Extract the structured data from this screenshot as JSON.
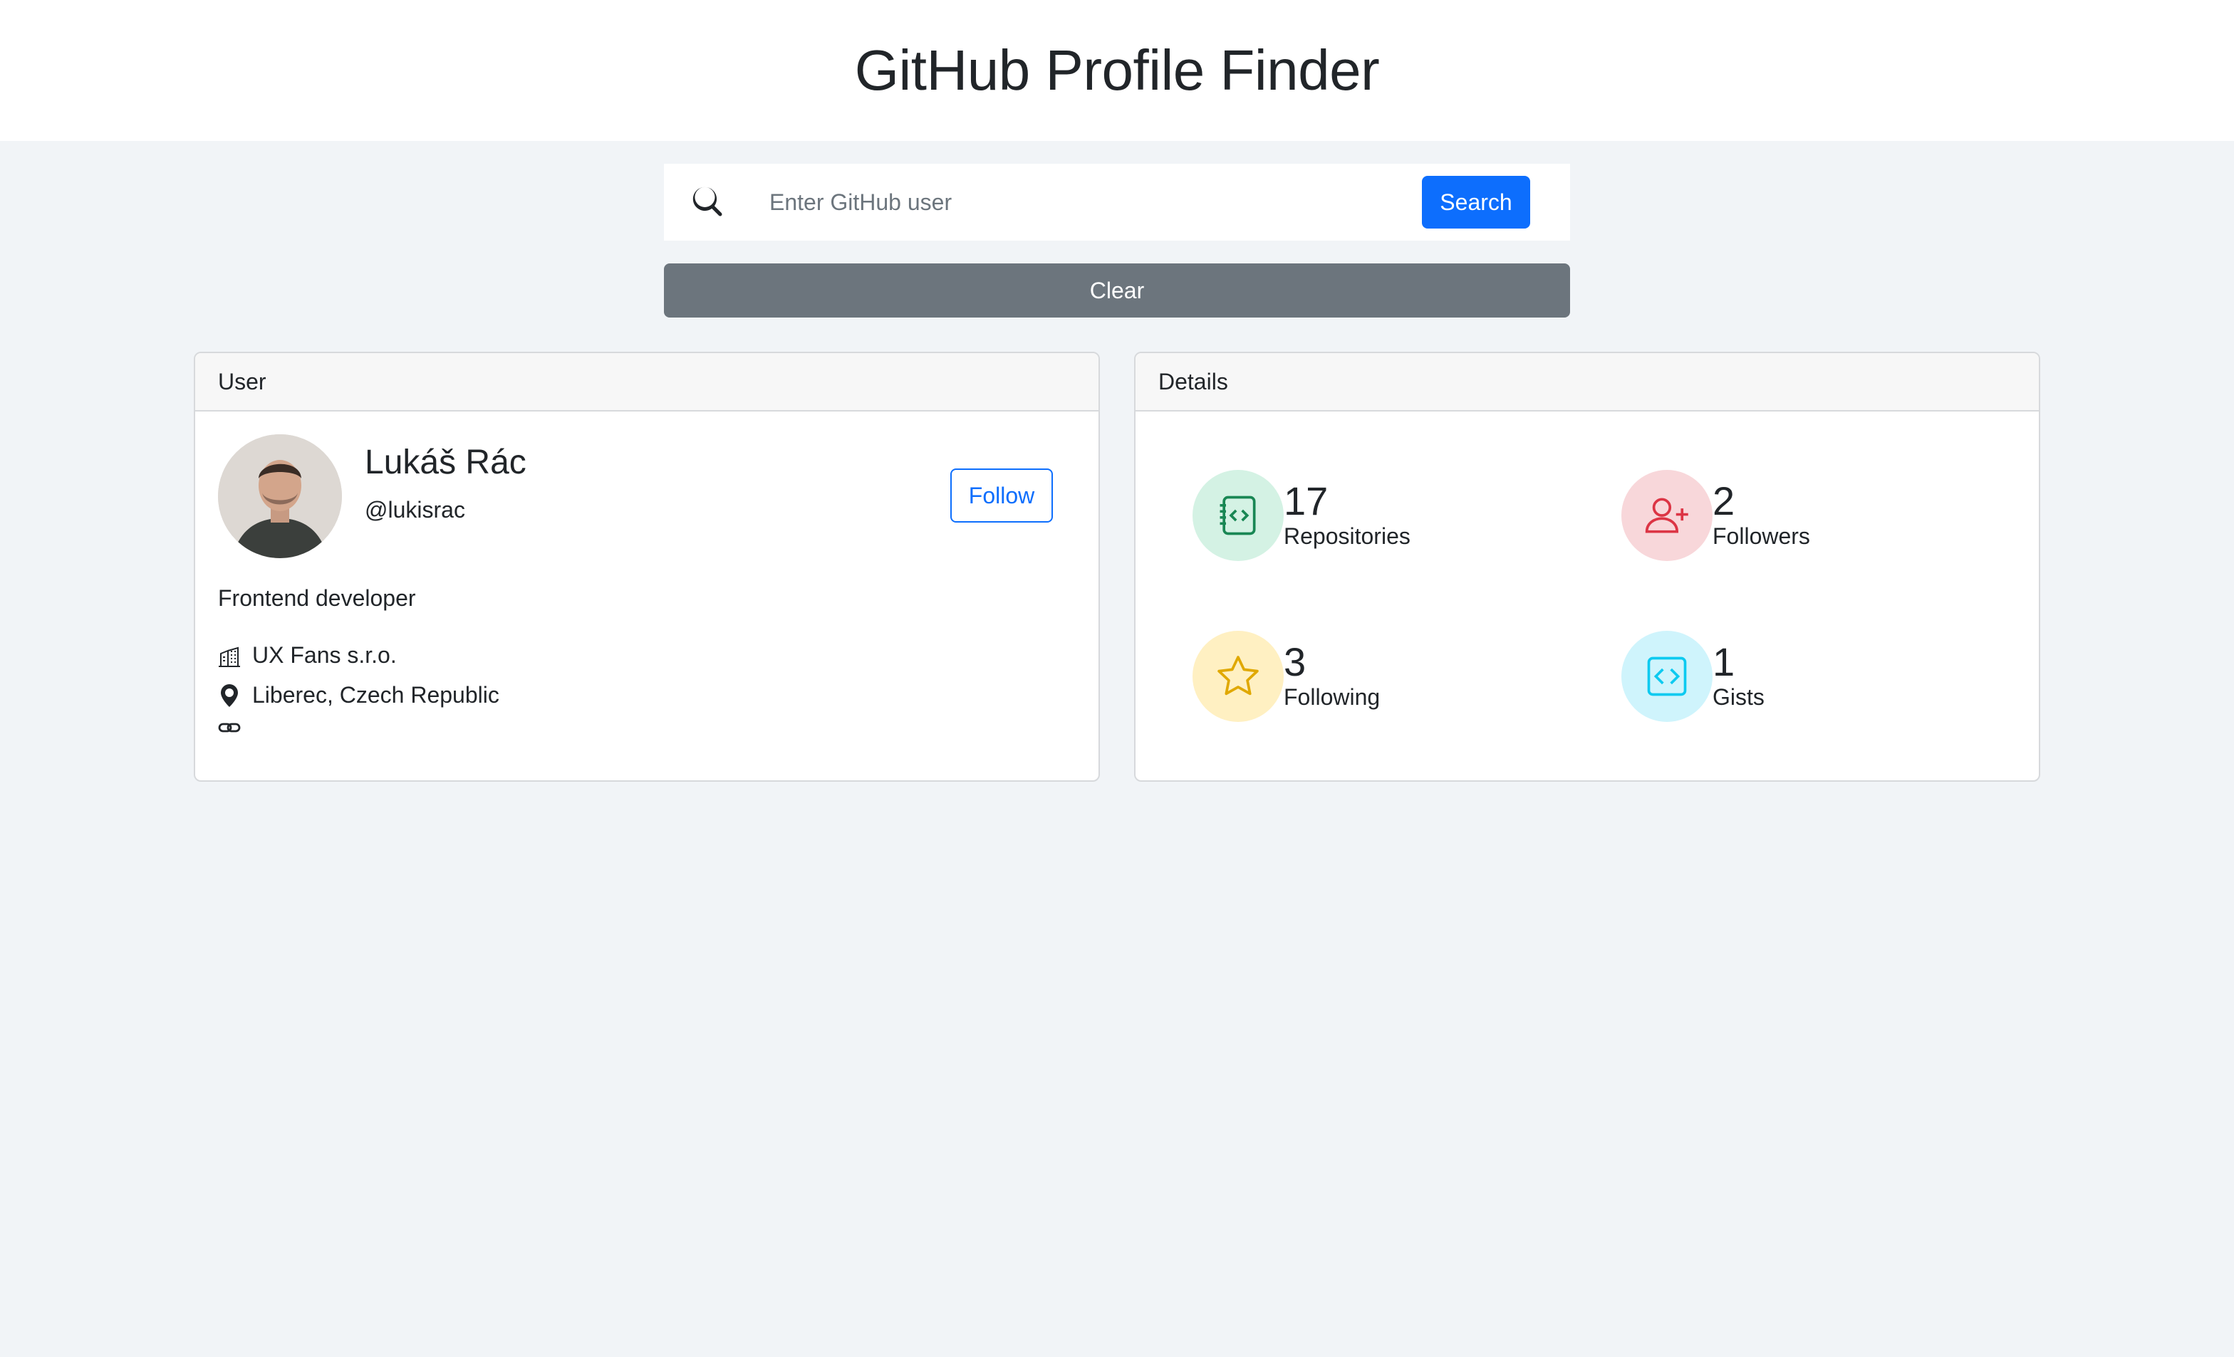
{
  "header": {
    "title": "GitHub Profile Finder"
  },
  "search": {
    "placeholder": "Enter GitHub user",
    "value": "",
    "button_label": "Search"
  },
  "clear": {
    "label": "Clear"
  },
  "user_card": {
    "header": "User",
    "name": "Lukáš Rác",
    "login": "@lukisrac",
    "follow_label": "Follow",
    "bio": "Frontend developer",
    "company": "UX Fans s.r.o.",
    "location": "Liberec, Czech Republic"
  },
  "details_card": {
    "header": "Details",
    "stats": [
      {
        "value": "17",
        "label": "Repositories",
        "icon": "repo-icon",
        "color": "#198754",
        "bg": "#d4f2e4"
      },
      {
        "value": "2",
        "label": "Followers",
        "icon": "person-add-icon",
        "color": "#dc3545",
        "bg": "#f8d7da"
      },
      {
        "value": "3",
        "label": "Following",
        "icon": "star-icon",
        "color": "#e0a800",
        "bg": "#fff0c2"
      },
      {
        "value": "1",
        "label": "Gists",
        "icon": "code-square-icon",
        "color": "#0dcaf0",
        "bg": "#cff4fc"
      }
    ]
  },
  "colors": {
    "primary": "#0d6efd",
    "secondary": "#6c757d",
    "background": "#f1f4f7"
  }
}
